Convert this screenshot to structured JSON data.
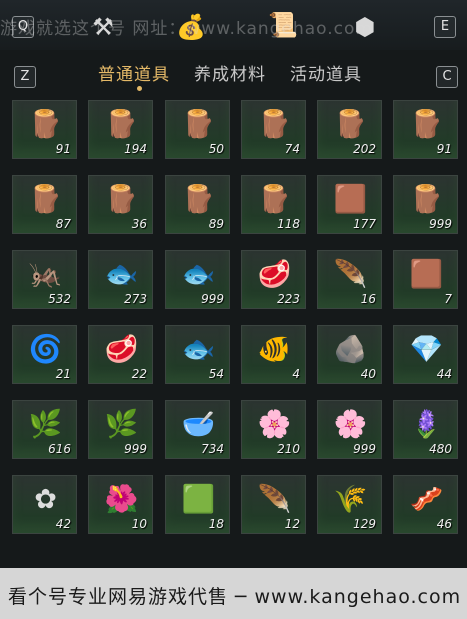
{
  "topbar": {
    "key_left": "Q",
    "key_right": "E",
    "watermark": "游戏就选这个号 网址：www.kangehao.com"
  },
  "tabs": {
    "key_prev": "Z",
    "key_next": "C",
    "items": [
      "普通道具",
      "养成材料",
      "活动道具"
    ]
  },
  "items": [
    {
      "icon": "log-bundle-icon",
      "glyph": "🪵",
      "qty": "91"
    },
    {
      "icon": "log-bundle-icon",
      "glyph": "🪵",
      "qty": "194"
    },
    {
      "icon": "log-bundle-icon",
      "glyph": "🪵",
      "qty": "50"
    },
    {
      "icon": "log-bundle-icon",
      "glyph": "🪵",
      "qty": "74"
    },
    {
      "icon": "log-bundle-icon",
      "glyph": "🪵",
      "qty": "202"
    },
    {
      "icon": "log-bundle-icon",
      "glyph": "🪵",
      "qty": "91"
    },
    {
      "icon": "log-bundle-icon",
      "glyph": "🪵",
      "qty": "87"
    },
    {
      "icon": "log-bundle-icon",
      "glyph": "🪵",
      "qty": "36"
    },
    {
      "icon": "log-bundle-icon",
      "glyph": "🪵",
      "qty": "89"
    },
    {
      "icon": "log-bundle-icon",
      "glyph": "🪵",
      "qty": "118"
    },
    {
      "icon": "bark-pile-icon",
      "glyph": "🟫",
      "qty": "177"
    },
    {
      "icon": "log-bundle-icon",
      "glyph": "🪵",
      "qty": "999"
    },
    {
      "icon": "insect-icon",
      "glyph": "🦗",
      "qty": "532"
    },
    {
      "icon": "fish-icon",
      "glyph": "🐟",
      "qty": "273"
    },
    {
      "icon": "fish-icon",
      "glyph": "🐟",
      "qty": "999"
    },
    {
      "icon": "raw-meat-icon",
      "glyph": "🥩",
      "qty": "223"
    },
    {
      "icon": "feather-icon",
      "glyph": "🪶",
      "qty": "16"
    },
    {
      "icon": "animal-hide-icon",
      "glyph": "🟫",
      "qty": "7"
    },
    {
      "icon": "intestine-icon",
      "glyph": "🌀",
      "qty": "21"
    },
    {
      "icon": "raw-meat-icon",
      "glyph": "🥩",
      "qty": "22"
    },
    {
      "icon": "fish-icon",
      "glyph": "🐟",
      "qty": "54"
    },
    {
      "icon": "golden-fish-icon",
      "glyph": "🐠",
      "qty": "4"
    },
    {
      "icon": "gold-ore-icon",
      "glyph": "🪨",
      "qty": "40"
    },
    {
      "icon": "purple-crystal-icon",
      "glyph": "💎",
      "qty": "44"
    },
    {
      "icon": "white-flower-herb-icon",
      "glyph": "🌿",
      "qty": "616"
    },
    {
      "icon": "white-flower-herb-icon",
      "glyph": "🌿",
      "qty": "999"
    },
    {
      "icon": "mortar-pestle-icon",
      "glyph": "🥣",
      "qty": "734"
    },
    {
      "icon": "purple-flower-icon",
      "glyph": "🌸",
      "qty": "210"
    },
    {
      "icon": "purple-flower-icon",
      "glyph": "🌸",
      "qty": "999"
    },
    {
      "icon": "lavender-herb-icon",
      "glyph": "🪻",
      "qty": "480"
    },
    {
      "icon": "small-white-flower-icon",
      "glyph": "✿",
      "qty": "42"
    },
    {
      "icon": "red-flower-icon",
      "glyph": "🌺",
      "qty": "10"
    },
    {
      "icon": "jade-stone-icon",
      "glyph": "🟩",
      "qty": "18"
    },
    {
      "icon": "white-feather-icon",
      "glyph": "🪶",
      "qty": "12"
    },
    {
      "icon": "dark-feather-icon",
      "glyph": "🌾",
      "qty": "129"
    },
    {
      "icon": "sliced-meat-icon",
      "glyph": "🥓",
      "qty": "46"
    }
  ],
  "footer": {
    "text": "看个号专业网易游戏代售 ─ www.kangehao.com"
  },
  "colors": {
    "accent": "#e4b968",
    "cell_bg": "#223b28"
  }
}
